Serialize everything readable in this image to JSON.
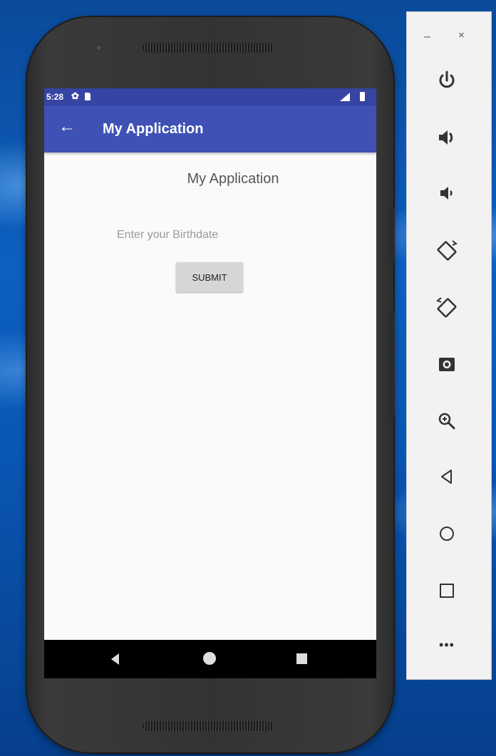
{
  "status_bar": {
    "time": "5:28"
  },
  "app_bar": {
    "title": "My Application"
  },
  "main": {
    "heading": "My Application",
    "birthdate_placeholder": "Enter your Birthdate",
    "birthdate_value": "",
    "submit_label": "SUBMIT"
  },
  "emulator_toolbar": {
    "minimize": "–",
    "close": "×",
    "more": "•••",
    "buttons": [
      "power-icon",
      "volume-up-icon",
      "volume-down-icon",
      "rotate-left-icon",
      "rotate-right-icon",
      "camera-icon",
      "zoom-icon",
      "back-icon",
      "home-icon",
      "overview-icon",
      "more-icon"
    ]
  },
  "colors": {
    "status_bar": "#3644a3",
    "app_bar": "#3f51b5",
    "screen_bg": "#fafafa",
    "button_bg": "#d6d6d6",
    "toolbar_icon": "#333333"
  }
}
